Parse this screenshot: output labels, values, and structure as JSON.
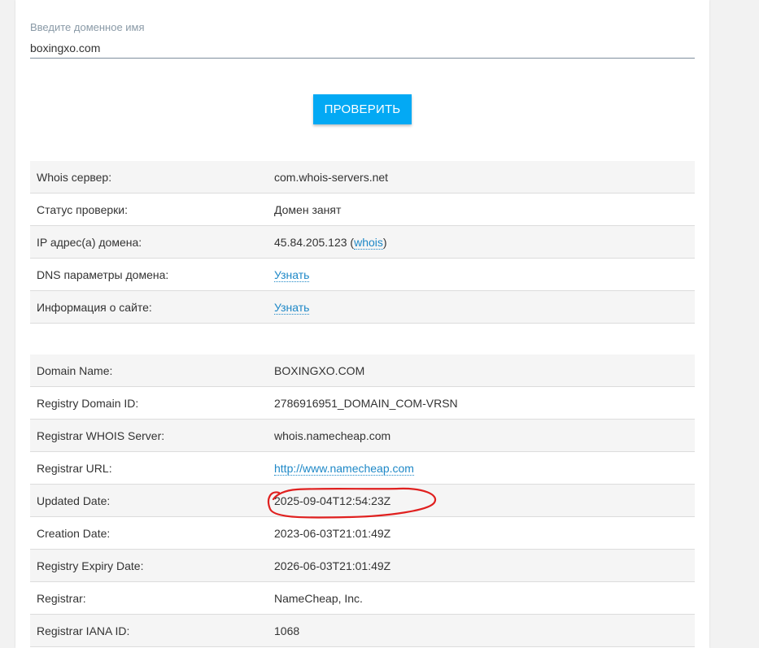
{
  "form": {
    "label": "Введите доменное имя",
    "value": "boxingxo.com",
    "button": "ПРОВЕРИТЬ"
  },
  "summary": {
    "rows": [
      {
        "key": "Whois сервер:",
        "value": "com.whois-servers.net"
      },
      {
        "key": "Статус проверки:",
        "value": "Домен занят"
      },
      {
        "key": "IP адрес(а) домена:",
        "value": "45.84.205.123",
        "link": "whois"
      },
      {
        "key": "DNS параметры домена:",
        "link": "Узнать"
      },
      {
        "key": "Информация о сайте:",
        "link": "Узнать"
      }
    ]
  },
  "whois": {
    "rows": [
      {
        "key": "Domain Name:",
        "value": "BOXINGXO.COM"
      },
      {
        "key": "Registry Domain ID:",
        "value": "2786916951_DOMAIN_COM-VRSN"
      },
      {
        "key": "Registrar WHOIS Server:",
        "value": "whois.namecheap.com"
      },
      {
        "key": "Registrar URL:",
        "link": "http://www.namecheap.com"
      },
      {
        "key": "Updated Date:",
        "value": "2025-09-04T12:54:23Z"
      },
      {
        "key": "Creation Date:",
        "value": "2023-06-03T21:01:49Z"
      },
      {
        "key": "Registry Expiry Date:",
        "value": "2026-06-03T21:01:49Z"
      },
      {
        "key": "Registrar:",
        "value": "NameCheap, Inc."
      },
      {
        "key": "Registrar IANA ID:",
        "value": "1068"
      }
    ]
  },
  "colors": {
    "accent": "#03a9f4",
    "link": "#1e88c7",
    "annotation": "#e0201f"
  }
}
